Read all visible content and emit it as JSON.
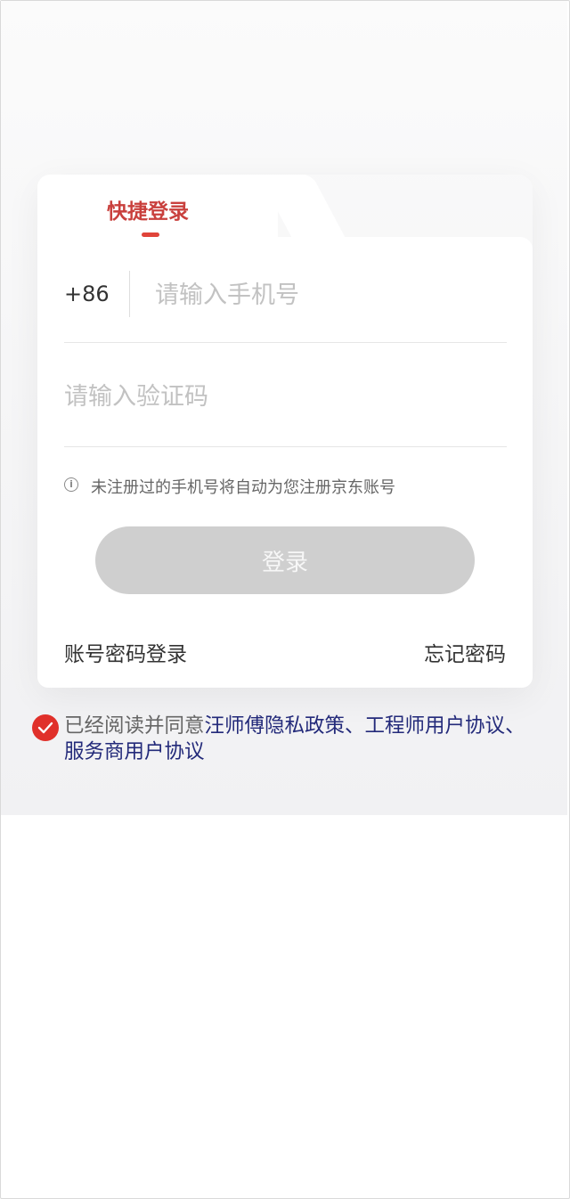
{
  "login": {
    "tab_label": "快捷登录",
    "country_code": "+86",
    "phone_placeholder": "请输入手机号",
    "code_placeholder": "请输入验证码",
    "notice": "未注册过的手机号将自动为您注册京东账号",
    "login_button": "登录",
    "password_login": "账号密码登录",
    "forgot_password": "忘记密码"
  },
  "agreement": {
    "prefix": "已经阅读并同意",
    "privacy": "汪师傅隐私政策",
    "sep1": "、",
    "engineer": "工程师用户协议",
    "sep2": "、",
    "merchant": "服务商用户协议",
    "checked": true
  },
  "icons": {
    "info": "info-icon",
    "check": "checkmark-icon"
  },
  "colors": {
    "accent_red": "#e0302a",
    "tab_red": "#c9403d",
    "link_blue": "#232a7a",
    "disabled_button": "#cfcfcf"
  }
}
